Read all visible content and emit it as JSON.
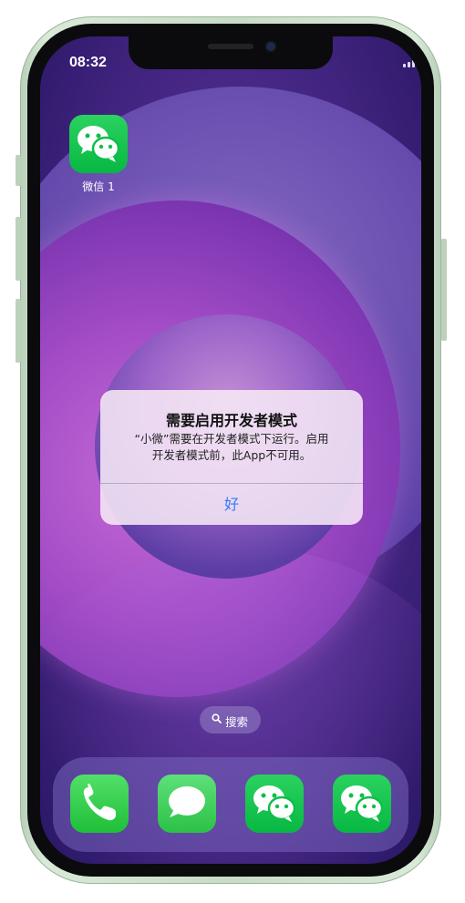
{
  "status_bar": {
    "time": "08:32",
    "icons": [
      "signal-icon",
      "wifi-icon",
      "battery-icon"
    ]
  },
  "home_screen": {
    "apps": [
      {
        "label": "微信 1",
        "icon": "wechat-icon"
      }
    ]
  },
  "alert": {
    "title": "需要启用开发者模式",
    "message_line1": "“小微”需要在开发者模式下运行。启用",
    "message_line2": "开发者模式前，此App不可用。",
    "ok_label": "好"
  },
  "search": {
    "label": "搜索",
    "icon": "search-icon"
  },
  "dock": {
    "apps": [
      "phone-icon",
      "messages-icon",
      "wechat-icon",
      "wechat-icon"
    ]
  },
  "colors": {
    "accent_link": "#2f7cf6",
    "app_green": "#07b843",
    "frame_green": "#c7dcc6",
    "wallpaper_purple": "#4b2a8a"
  }
}
